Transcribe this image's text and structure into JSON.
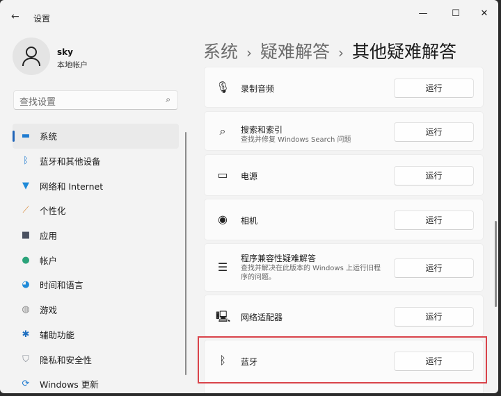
{
  "window": {
    "title": "设置",
    "back_icon": "arrow-left-icon",
    "minimize": "—",
    "maximize": "☐",
    "close": "✕"
  },
  "user": {
    "name": "sky",
    "type": "本地帐户"
  },
  "search": {
    "placeholder": "查找设置"
  },
  "nav": [
    {
      "label": "系统",
      "icon": "monitor-icon",
      "color": "#1f7bd0",
      "active": true
    },
    {
      "label": "蓝牙和其他设备",
      "icon": "bluetooth-icon",
      "color": "#1f7bd0"
    },
    {
      "label": "网络和 Internet",
      "icon": "wifi-icon",
      "color": "#1f8ad8"
    },
    {
      "label": "个性化",
      "icon": "brush-icon",
      "color": "#d98a3a"
    },
    {
      "label": "应用",
      "icon": "apps-icon",
      "color": "#4a5160"
    },
    {
      "label": "帐户",
      "icon": "person-icon",
      "color": "#2ba37a"
    },
    {
      "label": "时间和语言",
      "icon": "globe-clock-icon",
      "color": "#1f8ad8"
    },
    {
      "label": "游戏",
      "icon": "gamepad-icon",
      "color": "#888888"
    },
    {
      "label": "辅助功能",
      "icon": "accessibility-icon",
      "color": "#1f6fc0"
    },
    {
      "label": "隐私和安全性",
      "icon": "shield-icon",
      "color": "#8a8f98"
    },
    {
      "label": "Windows 更新",
      "icon": "update-icon",
      "color": "#1f7bd0"
    }
  ],
  "breadcrumb": [
    "系统",
    "疑难解答",
    "其他疑难解答"
  ],
  "troubleshooters": [
    {
      "title": "录制音频",
      "icon": "microphone-icon",
      "button": "运行"
    },
    {
      "title": "搜索和索引",
      "desc": "查找并修复 Windows Search 问题",
      "icon": "search-icon",
      "button": "运行"
    },
    {
      "title": "电源",
      "icon": "battery-icon",
      "button": "运行"
    },
    {
      "title": "相机",
      "icon": "camera-icon",
      "button": "运行"
    },
    {
      "title": "程序兼容性疑难解答",
      "desc": "查找并解决在此版本的 Windows 上运行旧程序的问题。",
      "icon": "list-icon",
      "button": "运行"
    },
    {
      "title": "网络适配器",
      "icon": "network-adapter-icon",
      "button": "运行"
    },
    {
      "title": "蓝牙",
      "icon": "bluetooth-icon",
      "button": "运行",
      "highlighted": true
    }
  ],
  "highlight_color": "#d9434a"
}
